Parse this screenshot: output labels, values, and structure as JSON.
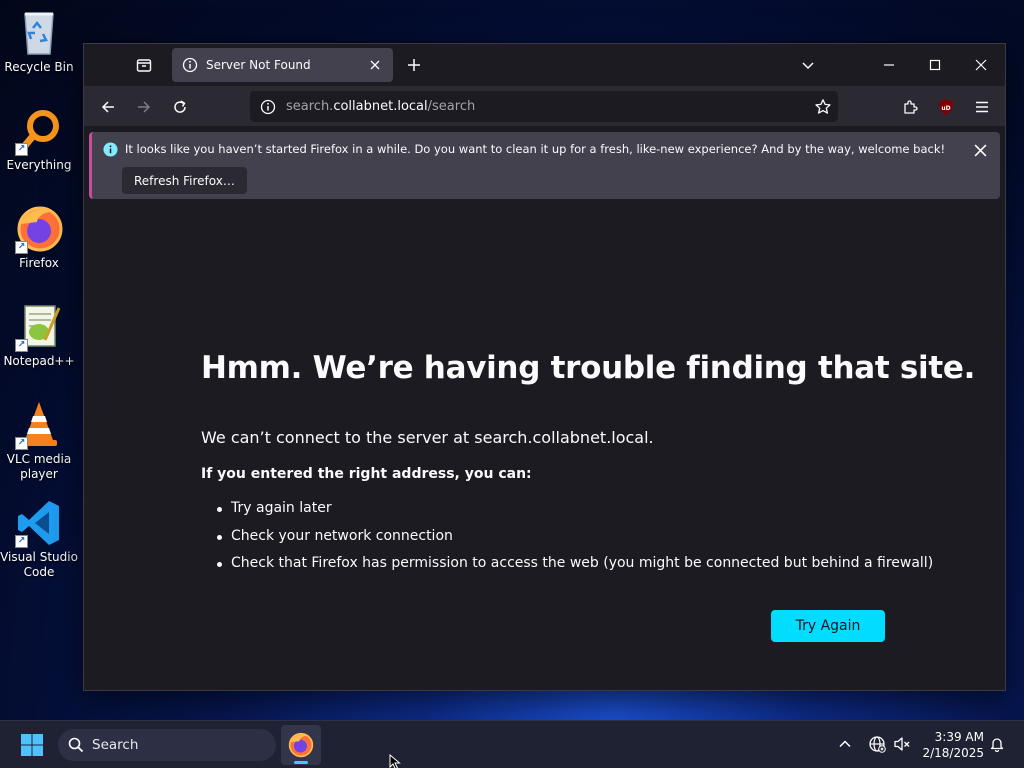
{
  "desktop": {
    "icons": [
      {
        "label": "Recycle Bin",
        "icon": "recycle-bin-icon"
      },
      {
        "label": "Everything",
        "icon": "everything-search-icon"
      },
      {
        "label": "Firefox",
        "icon": "firefox-icon"
      },
      {
        "label": "Notepad++",
        "icon": "notepad-plus-plus-icon"
      },
      {
        "label": "VLC media player",
        "icon": "vlc-icon"
      },
      {
        "label": "Visual Studio Code",
        "icon": "vscode-icon"
      }
    ]
  },
  "browser": {
    "tab": {
      "title": "Server Not Found"
    },
    "url": {
      "prefix": "search.",
      "host": "collabnet.local",
      "path": "/search"
    },
    "notification": {
      "message": "It looks like you haven’t started Firefox in a while. Do you want to clean it up for a fresh, like-new experience? And by the way, welcome back!",
      "button": "Refresh Firefox…"
    },
    "error": {
      "title": "Hmm. We’re having trouble finding that site.",
      "lead": "We can’t connect to the server at search.collabnet.local.",
      "subtitle": "If you entered the right address, you can:",
      "suggestions": [
        "Try again later",
        "Check your network connection",
        "Check that Firefox has permission to access the web (you might be connected but behind a firewall)"
      ],
      "button": "Try Again"
    },
    "accent": "#00ddff"
  },
  "taskbar": {
    "search_placeholder": "Search",
    "time": "3:39 AM",
    "date": "2/18/2025"
  }
}
